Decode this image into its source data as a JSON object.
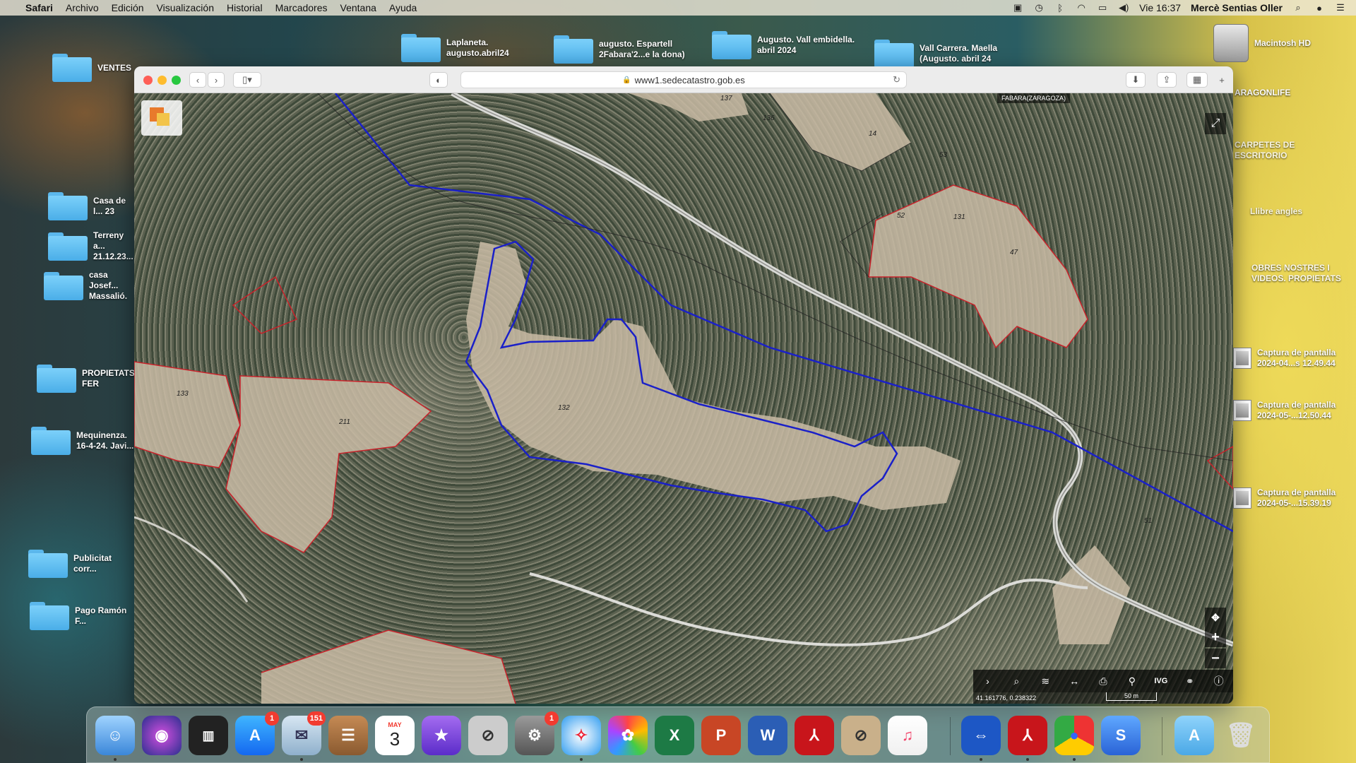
{
  "menubar": {
    "app": "Safari",
    "items": [
      "Archivo",
      "Edición",
      "Visualización",
      "Historial",
      "Marcadores",
      "Ventana",
      "Ayuda"
    ],
    "clock": "Vie 16:37",
    "user": "Mercè Sentias Oller"
  },
  "desktop": {
    "left_icons": [
      {
        "label": "VENTES"
      },
      {
        "label": "Casa de l... 23"
      },
      {
        "label": "Terreny a... 21.12.23..."
      },
      {
        "label": "casa Josef... Massalió."
      },
      {
        "label": "PROPIETATS FER"
      },
      {
        "label": "Mequinenza. 16-4-24. Javi..."
      },
      {
        "label": "Publicitat corr..."
      },
      {
        "label": "Pago Ramón F..."
      }
    ],
    "top_icons": [
      {
        "label": "Laplaneta. augusto.abril24"
      },
      {
        "label": "augusto. Espartell 2Fabara'2...e la dona)"
      },
      {
        "label": "Augusto. Vall embidella. abril 2024"
      },
      {
        "label": "Vall Carrera. Maella (Augusto. abril 24"
      }
    ],
    "right_icons": [
      {
        "label": "Macintosh HD"
      },
      {
        "label": "ARAGONLIFE"
      },
      {
        "label": "CARPETES DE ESCRITORIO"
      },
      {
        "label": "Llibre angles"
      },
      {
        "label": "OBRES NOSTRES I VIDEOS. PROPIETATS"
      },
      {
        "label": "Captura de pantalla 2024-04...s 12.49.44"
      },
      {
        "label": "Captura de pantalla 2024-05-...12.50.44"
      },
      {
        "label": "Captura de pantalla 2024-05-...15.39.19"
      }
    ]
  },
  "browser": {
    "url": "www1.sedecatastro.gob.es"
  },
  "map": {
    "municipality": "FABARA(ZARAGOZA)",
    "parcel_labels": [
      "132",
      "133",
      "211",
      "136",
      "137",
      "53",
      "131",
      "47",
      "14",
      "52",
      "51"
    ],
    "coordinates": "41.161776, 0.238322",
    "scale": "50 m",
    "tools": [
      "chevron-right-icon",
      "search-icon",
      "layers-icon",
      "measure-icon",
      "print-icon",
      "pin-icon",
      "IVG",
      "share-icon",
      "info-icon"
    ],
    "ivg_label": "IVG"
  },
  "dock": {
    "calendar_month": "MAY",
    "calendar_day": "3",
    "badges": {
      "appstore": "1",
      "mail": "151",
      "settings": "1"
    }
  }
}
